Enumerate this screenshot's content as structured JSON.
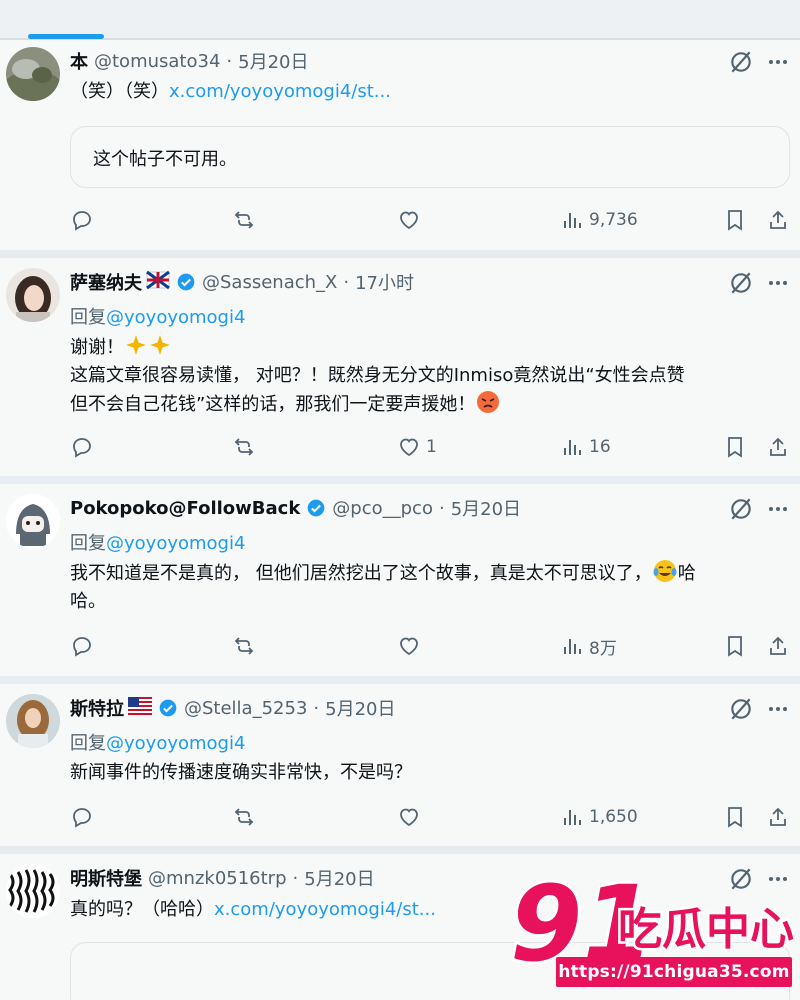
{
  "posts": [
    {
      "name": "本",
      "handle": "@tomusato34",
      "time": "5月20日",
      "text": "（笑）（笑）",
      "link": "x.com/yoyoyomogi4/st...",
      "quote": "这个帖子不可用。",
      "stats": {
        "replies": "",
        "reposts": "",
        "likes": "",
        "views": "9,736"
      }
    },
    {
      "name": "萨塞纳夫",
      "handle": "@Sassenach_X",
      "time": "17小时",
      "verified": true,
      "reply_prefix": "回复",
      "reply_to": "@yoyoyomogi4",
      "line1": "谢谢！",
      "line2": "这篇文章很容易读懂， 对吧？！既然身无分文的Inmiso竟然说出“女性会点赞",
      "line3": "但不会自己花钱”这样的话，那我们一定要声援她！",
      "stats": {
        "replies": "",
        "reposts": "",
        "likes": "1",
        "views": "16"
      }
    },
    {
      "name": "Pokopoko@FollowBack",
      "handle": "@pco__pco",
      "time": "5月20日",
      "verified": true,
      "reply_prefix": "回复",
      "reply_to": "@yoyoyomogi4",
      "line1": "我不知道是不是真的， 但他们居然挖出了这个故事，真是太不可思议了，",
      "line1b": "哈",
      "line2": "哈。",
      "stats": {
        "replies": "",
        "reposts": "",
        "likes": "",
        "views": "8万"
      }
    },
    {
      "name": "斯特拉",
      "handle": "@Stella_5253",
      "time": "5月20日",
      "verified": true,
      "reply_prefix": "回复",
      "reply_to": "@yoyoyomogi4",
      "line1": "新闻事件的传播速度确实非常快，不是吗？",
      "stats": {
        "replies": "",
        "reposts": "",
        "likes": "",
        "views": "1,650"
      }
    },
    {
      "name": "明斯特堡",
      "handle": "@mnzk0516trp",
      "time": "5月20日",
      "text": "真的吗？（哈哈）",
      "link": "x.com/yoyoyomogi4/st..."
    }
  ],
  "watermark": {
    "brand_num": "91",
    "brand_text": "吃瓜中心",
    "url": "https://91chigua35.com"
  },
  "colors": {
    "accent": "#1d9bf0",
    "muted": "#536471",
    "watermark": "#e8125c"
  }
}
